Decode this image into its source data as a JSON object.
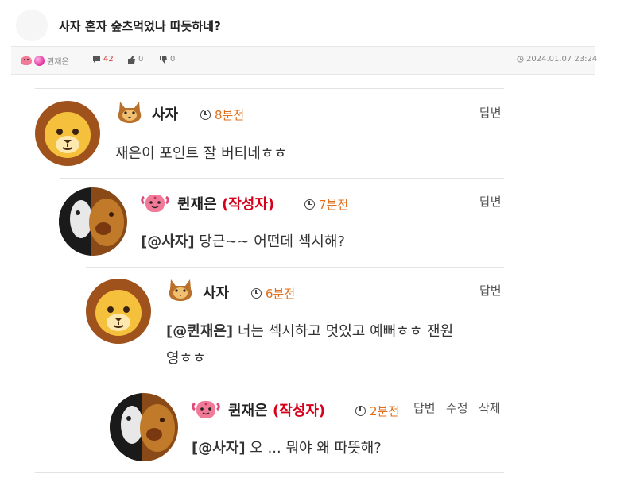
{
  "post": {
    "title": "사자 혼자 숲츠먹었나 따듯하네?",
    "author": "퀸재은",
    "comment_count": "42",
    "likes": "0",
    "dislikes": "0",
    "datetime": "2024.01.07 23:24"
  },
  "colors": {
    "author_tag": "#d6001c",
    "time": "#e0701c",
    "comment_count": "#d32f2f"
  },
  "comments": [
    {
      "nick": "사자",
      "author_tag": "",
      "time": "8분전",
      "mention": "",
      "text": "재은이 포인트 잘 버티네ㅎㅎ",
      "actions": [
        "답변"
      ]
    },
    {
      "nick": "퀸재은",
      "author_tag": "(작성자)",
      "time": "7분전",
      "mention": "[@사자]",
      "text": " 당근~~ 어떤데 섹시해?",
      "actions": [
        "답변"
      ]
    },
    {
      "nick": "사자",
      "author_tag": "",
      "time": "6분전",
      "mention": "[@퀸재은]",
      "text": " 너는 섹시하고 멋있고 예뻐ㅎㅎ 잰원",
      "text_line2": "영ㅎㅎ",
      "actions": [
        "답변"
      ]
    },
    {
      "nick": "퀸재은",
      "author_tag": "(작성자)",
      "time": "2분전",
      "mention": "[@사자]",
      "text": " 오 ... 뭐야 왜 따뜻해?",
      "actions": [
        "답변",
        "수정",
        "삭제"
      ]
    }
  ]
}
